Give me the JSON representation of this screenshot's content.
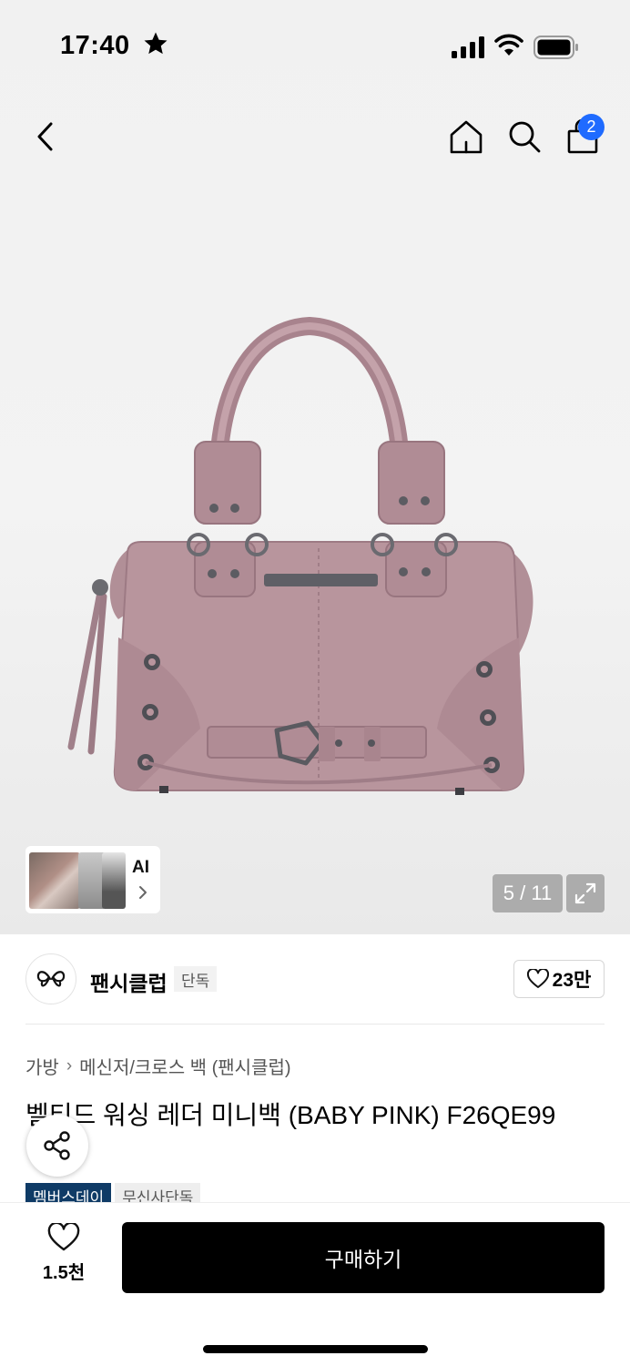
{
  "status_bar": {
    "time": "17:40",
    "focus_icon": "star-icon"
  },
  "nav": {
    "back_icon": "chevron-left-icon",
    "home_icon": "home-icon",
    "search_icon": "search-icon",
    "cart_icon": "shopping-bag-icon",
    "cart_badge": "2",
    "badge_color": "#1f6bff"
  },
  "gallery": {
    "image_counter": "5 / 11",
    "ai_label": "AI",
    "expand_icon": "expand-icon"
  },
  "brand": {
    "name": "팬시클럽",
    "tag": "단독",
    "like_count": "23만"
  },
  "product": {
    "breadcrumb": [
      "가방",
      "메신저/크로스 백 (팬시클럽)"
    ],
    "title": "벨티드 워싱 레더 미니백 (BABY PINK) F26QE99",
    "badges": [
      "멤버스데이",
      "무신사단독"
    ],
    "badge_color": "#0f3b66"
  },
  "bottom_bar": {
    "wish_count": "1.5천",
    "buy_label": "구매하기"
  }
}
